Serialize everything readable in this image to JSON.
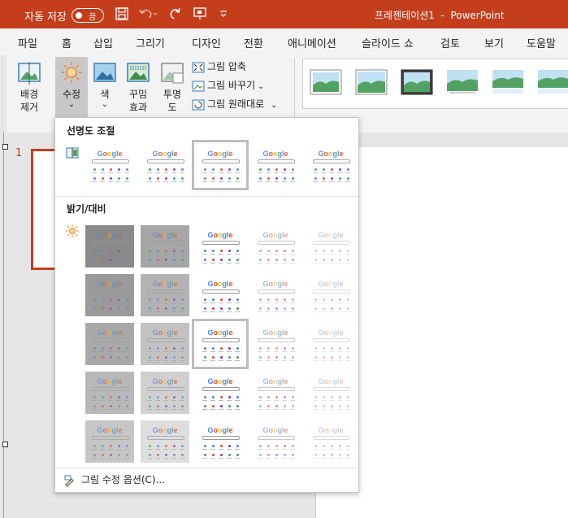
{
  "titlebar": {
    "autosave_label": "자동 저장",
    "autosave_toggle": "끔",
    "title": "프레젠테이션1  -  PowerPoint",
    "icons": [
      "save-icon",
      "undo-icon",
      "redo-icon",
      "present-icon",
      "customize-qat-icon"
    ]
  },
  "tabs": [
    "파일",
    "홈",
    "삽입",
    "그리기",
    "디자인",
    "전환",
    "애니메이션",
    "슬라이드 쇼",
    "검토",
    "보기",
    "도움말"
  ],
  "ribbon": {
    "remove_bg": "배경\n제거",
    "corrections": "수정",
    "color": "색",
    "artistic": "꾸밈\n효과",
    "transparency": "투명\n도",
    "compress": "그림 압축",
    "change": "그림 바꾸기",
    "reset": "그림 원래대로",
    "dropdown_arrow": "⌄"
  },
  "slide_number": "1",
  "dropdown": {
    "sharpness_title": "선명도 조절",
    "brightness_title": "밝기/대비",
    "google_label": "Google",
    "options_label": "그림 수정 옵션(C)..."
  },
  "colors": {
    "title_bg": "#c43e1c",
    "selected_outline": "#bdbdbd"
  }
}
